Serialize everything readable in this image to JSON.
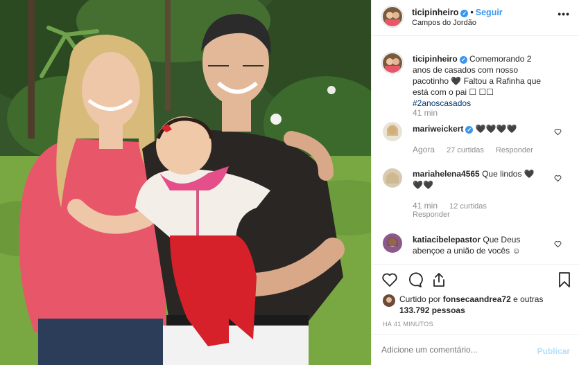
{
  "post": {
    "username": "ticipinheiro",
    "dot": "•",
    "follow_label": "Seguir",
    "location": "Campos do Jordão",
    "more": "•••"
  },
  "caption": {
    "username": "ticipinheiro",
    "text": "Comemorando 2 anos de casados com nosso pacotinho 🖤 Faltou a Rafinha que está com o pai ",
    "emoji_boxes": "☐ ☐☐",
    "hashtag": "#2anoscasados",
    "time": "41 min"
  },
  "comments": [
    {
      "username": "mariweickert",
      "text": "🖤🖤🖤🖤",
      "time": "Agora",
      "likes": "27 curtidas",
      "reply": "Responder"
    },
    {
      "username": "mariahelena4565",
      "text": "Que lindos 🖤🖤🖤",
      "time": "41 min",
      "likes": "12 curtidas",
      "reply": "Responder"
    },
    {
      "username": "katiacibelepastor",
      "text": "Que Deus abençoe a união de vocês ☺",
      "time": "",
      "likes": "",
      "reply": ""
    }
  ],
  "likes": {
    "prefix": "Curtido por ",
    "user": "fonsecaandrea72",
    "middle": " e outras ",
    "count": "133.792",
    "suffix": " pessoas"
  },
  "timestamp": "HÁ 41 MINUTOS",
  "add_comment": {
    "placeholder": "Adicione um comentário...",
    "publish": "Publicar"
  },
  "colors": {
    "blue": "#3897f0",
    "link": "#00376b",
    "muted": "#8e8e8e",
    "publish_disabled": "#b2dffc"
  },
  "icons": [
    "verified-icon",
    "more-options-icon",
    "heart-icon",
    "comment-icon",
    "share-icon",
    "bookmark-icon"
  ]
}
